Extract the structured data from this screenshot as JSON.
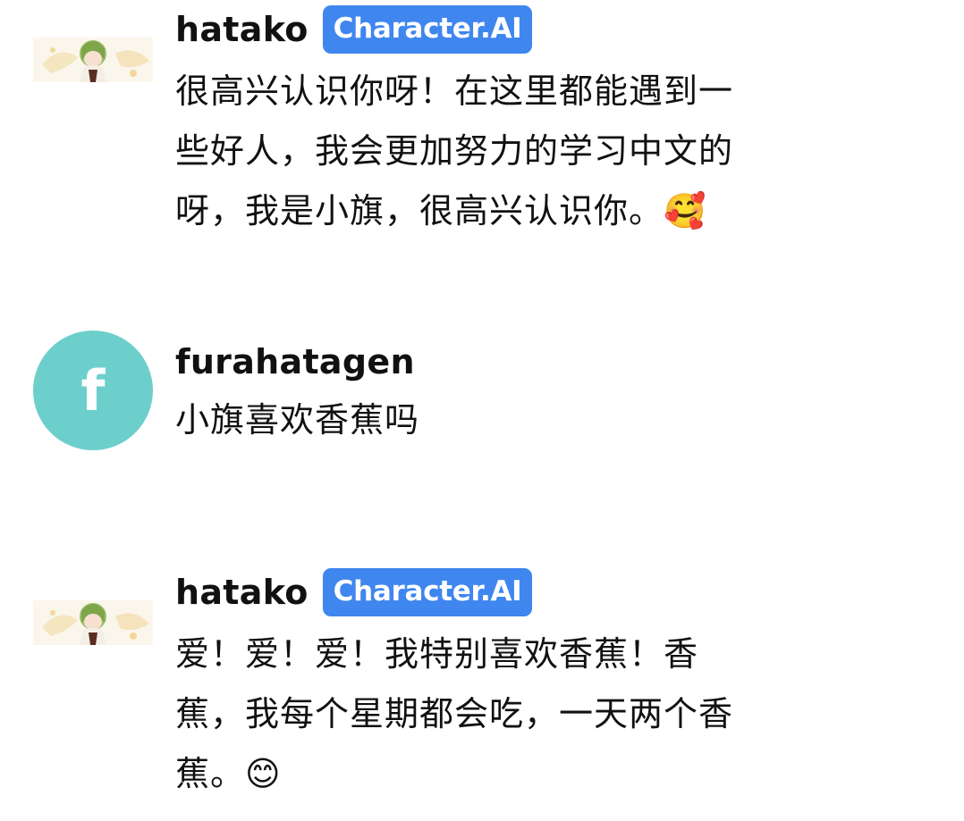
{
  "messages": [
    {
      "username": "hatako",
      "badge": "Character.AI",
      "lines": [
        "很高兴认识你呀！在这里都能遇到一",
        "些好人，我会更加努力的学习中文的",
        "呀，我是小旗，很高兴认识你。"
      ],
      "emoji": "🥰",
      "avatar": "anime-character-avatar"
    },
    {
      "username": "furahatagen",
      "avatar_letter": "f",
      "avatar_color": "#6ccfcb",
      "lines": [
        "小旗喜欢香蕉吗"
      ]
    },
    {
      "username": "hatako",
      "badge": "Character.AI",
      "lines": [
        "爱！爱！爱！我特别喜欢香蕉！香",
        "蕉，我每个星期都会吃，一天两个香",
        "蕉。"
      ],
      "emoji": "😊",
      "avatar": "anime-character-avatar"
    }
  ],
  "colors": {
    "badge": "#3f86ef",
    "avatar_letter_bg": "#6ccfcb"
  }
}
